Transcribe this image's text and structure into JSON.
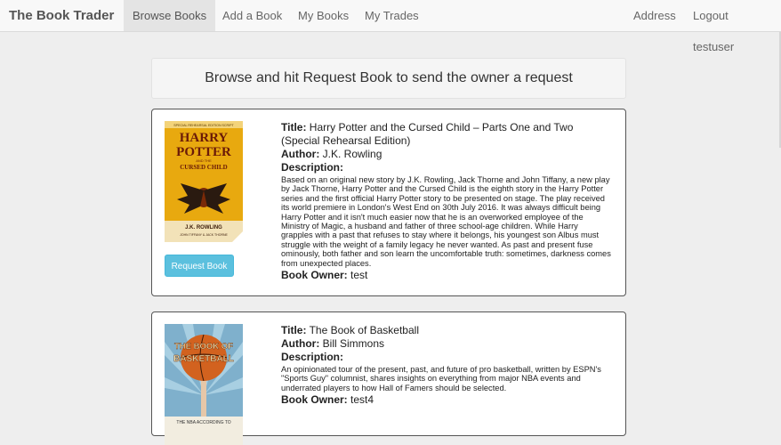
{
  "nav": {
    "brand": "The Book Trader",
    "links": [
      "Browse Books",
      "Add a Book",
      "My Books",
      "My Trades"
    ],
    "right_links": [
      "Address",
      "Logout testuser"
    ]
  },
  "banner": {
    "text": "Browse and hit Request Book to send the owner a request"
  },
  "labels": {
    "title": "Title:",
    "author": "Author:",
    "description": "Description:",
    "owner": "Book Owner:"
  },
  "books": [
    {
      "title": "Harry Potter and the Cursed Child – Parts One and Two (Special Rehearsal Edition)",
      "author": "J.K. Rowling",
      "description": "Based on an original new story by J.K. Rowling, Jack Thorne and John Tiffany, a new play by Jack Thorne, Harry Potter and the Cursed Child is the eighth story in the Harry Potter series and the first official Harry Potter story to be presented on stage. The play received its world premiere in London's West End on 30th July 2016. It was always difficult being Harry Potter and it isn't much easier now that he is an overworked employee of the Ministry of Magic, a husband and father of three school-age children. While Harry grapples with a past that refuses to stay where it belongs, his youngest son Albus must struggle with the weight of a family legacy he never wanted. As past and present fuse ominously, both father and son learn the uncomfortable truth: sometimes, darkness comes from unexpected places.",
      "owner": "test",
      "button": "Request Book",
      "cover": {
        "top_text": "SPECIAL REHEARSAL EDITION SCRIPT",
        "line1": "HARRY",
        "line2": "POTTER",
        "sub1": "AND THE",
        "sub2": "CURSED CHILD",
        "author": "J.K. ROWLING",
        "credits": "JOHN TIFFANY & JACK THORNE"
      }
    },
    {
      "title": "The Book of Basketball",
      "author": "Bill Simmons",
      "description": "An opinionated tour of the present, past, and future of pro basketball, written by ESPN's \"Sports Guy\" columnist, shares insights on everything from major NBA events and underrated players to how Hall of Famers should be selected.",
      "owner": "test4",
      "cover": {
        "line1": "THE BOOK OF",
        "line2": "BASKETBALL",
        "bottom": "THE NBA ACCORDING TO"
      }
    }
  ],
  "colors": {
    "request_button": "#5bc0de",
    "hp_cover": "#e8a90f",
    "bb_cover": "#7fb0cc"
  }
}
